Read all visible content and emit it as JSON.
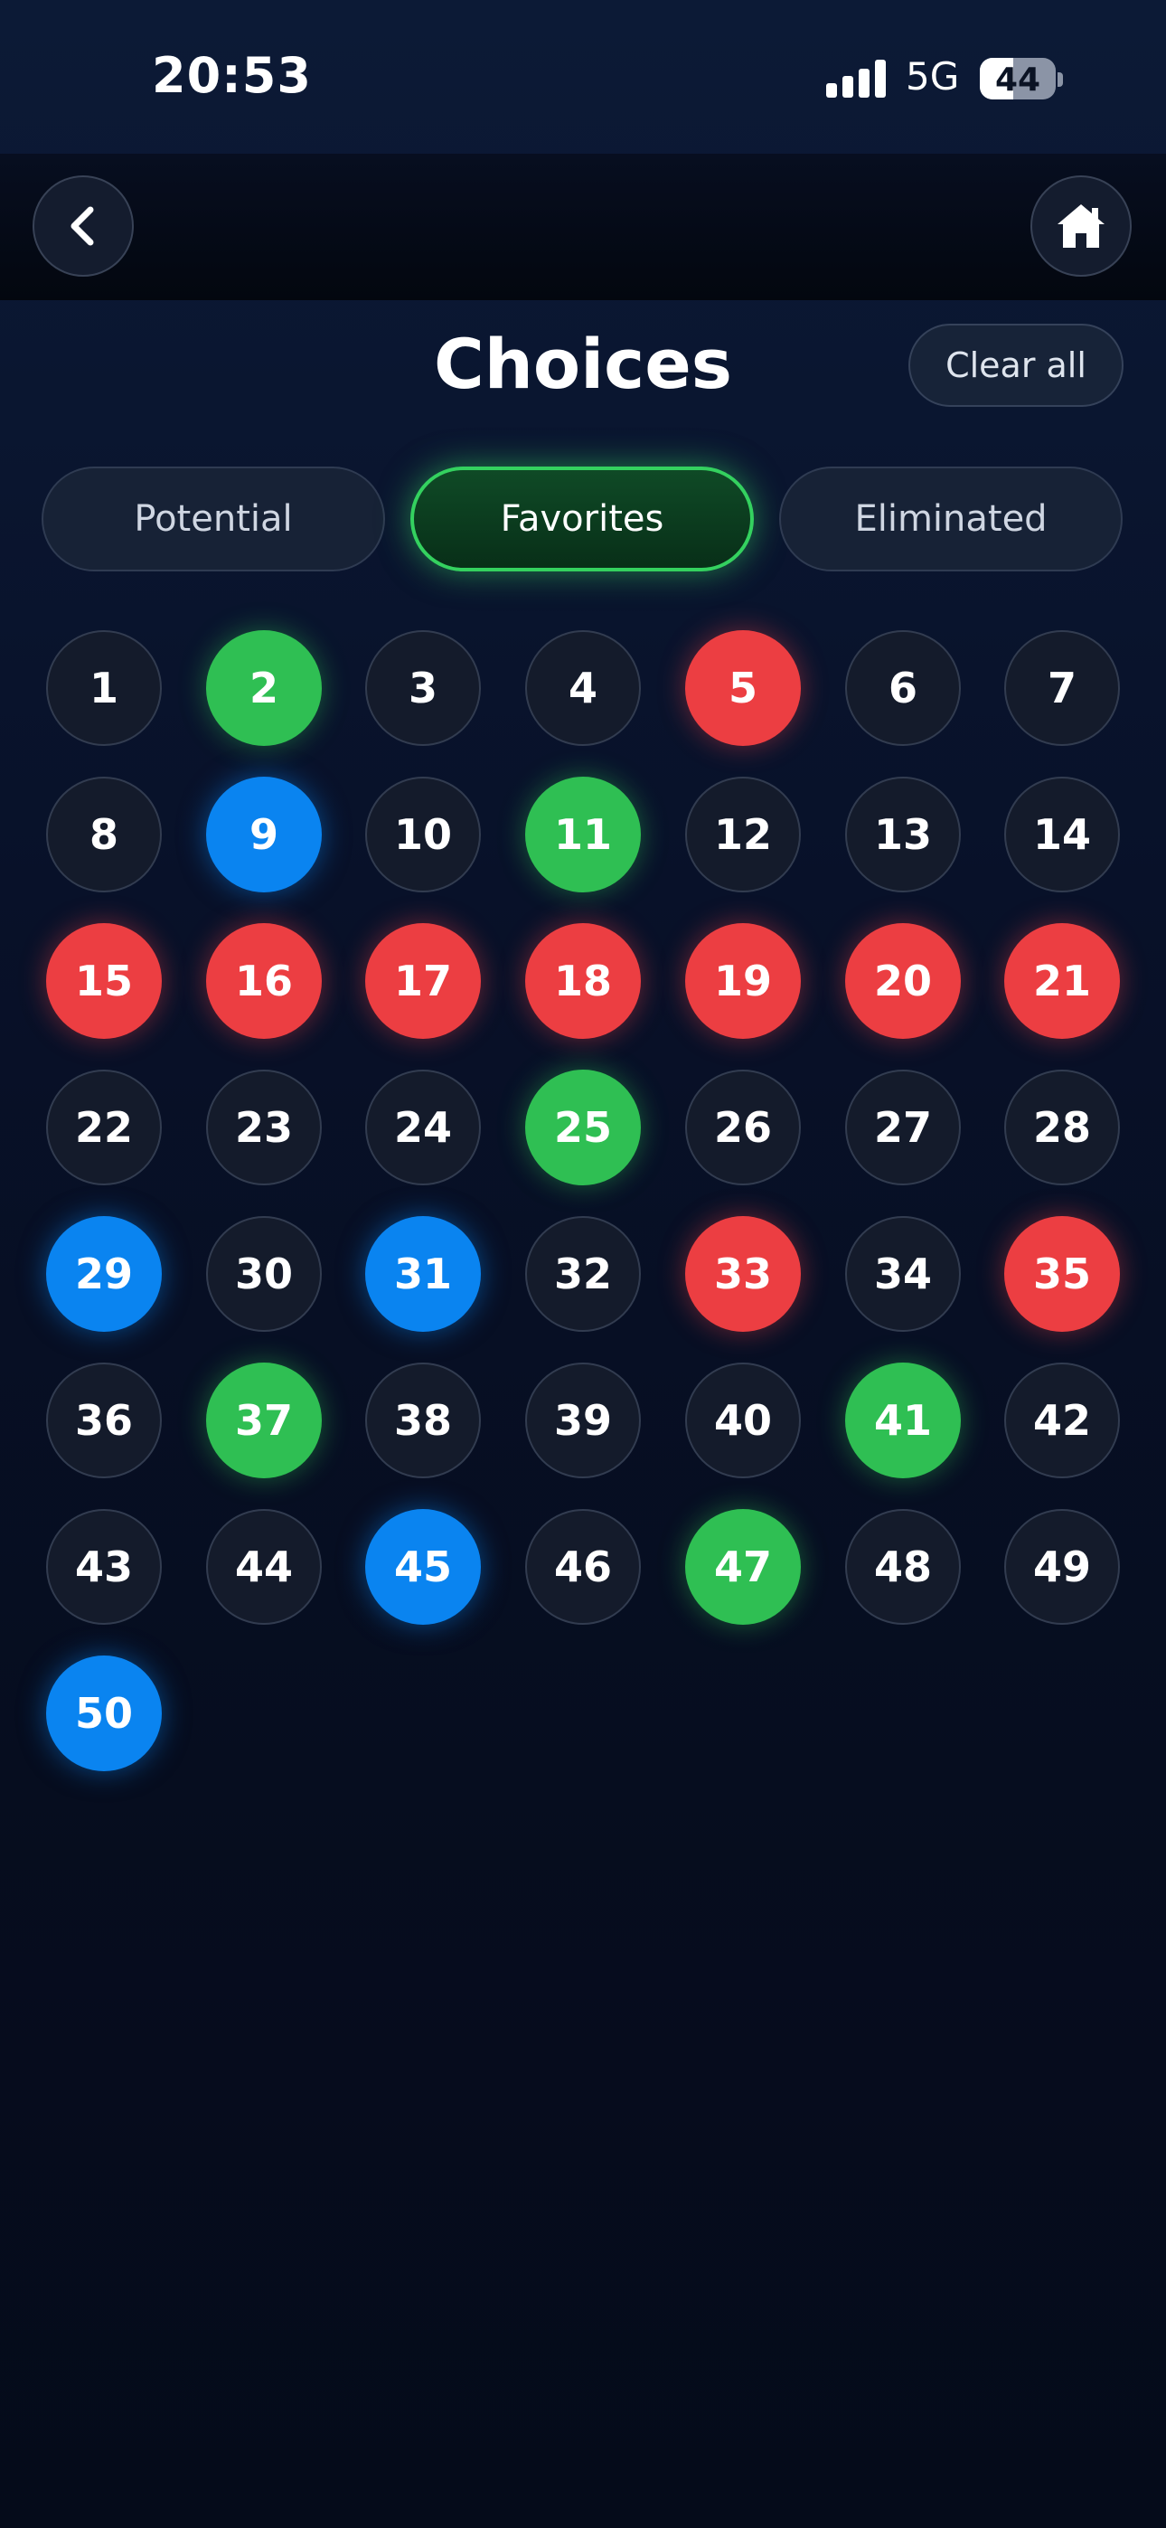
{
  "status_bar": {
    "time": "20:53",
    "network": "5G",
    "battery_level": "44",
    "battery_fraction": 0.44,
    "signal_bars": 4,
    "signal_icon": "cellular-signal-icon",
    "battery_icon": "battery-icon"
  },
  "nav": {
    "back_icon": "chevron-left-icon",
    "home_icon": "home-icon"
  },
  "header": {
    "title": "Choices",
    "clear_label": "Clear all"
  },
  "tabs": [
    {
      "label": "Potential",
      "selected": false
    },
    {
      "label": "Favorites",
      "selected": true
    },
    {
      "label": "Eliminated",
      "selected": false
    }
  ],
  "colors": {
    "background": "#070f22",
    "favorite": "#2fbf53",
    "eliminated": "#ec3e42",
    "potential": "#0a84f0",
    "unmarked": "#141b2b",
    "active_tab_border": "#34d15f"
  },
  "grid": {
    "columns": 7,
    "numbers": [
      {
        "n": "1",
        "state": "none"
      },
      {
        "n": "2",
        "state": "green"
      },
      {
        "n": "3",
        "state": "none"
      },
      {
        "n": "4",
        "state": "none"
      },
      {
        "n": "5",
        "state": "red"
      },
      {
        "n": "6",
        "state": "none"
      },
      {
        "n": "7",
        "state": "none"
      },
      {
        "n": "8",
        "state": "none"
      },
      {
        "n": "9",
        "state": "blue"
      },
      {
        "n": "10",
        "state": "none"
      },
      {
        "n": "11",
        "state": "green"
      },
      {
        "n": "12",
        "state": "none"
      },
      {
        "n": "13",
        "state": "none"
      },
      {
        "n": "14",
        "state": "none"
      },
      {
        "n": "15",
        "state": "red"
      },
      {
        "n": "16",
        "state": "red"
      },
      {
        "n": "17",
        "state": "red"
      },
      {
        "n": "18",
        "state": "red"
      },
      {
        "n": "19",
        "state": "red"
      },
      {
        "n": "20",
        "state": "red"
      },
      {
        "n": "21",
        "state": "red"
      },
      {
        "n": "22",
        "state": "none"
      },
      {
        "n": "23",
        "state": "none"
      },
      {
        "n": "24",
        "state": "none"
      },
      {
        "n": "25",
        "state": "green"
      },
      {
        "n": "26",
        "state": "none"
      },
      {
        "n": "27",
        "state": "none"
      },
      {
        "n": "28",
        "state": "none"
      },
      {
        "n": "29",
        "state": "blue"
      },
      {
        "n": "30",
        "state": "none"
      },
      {
        "n": "31",
        "state": "blue"
      },
      {
        "n": "32",
        "state": "none"
      },
      {
        "n": "33",
        "state": "red"
      },
      {
        "n": "34",
        "state": "none"
      },
      {
        "n": "35",
        "state": "red"
      },
      {
        "n": "36",
        "state": "none"
      },
      {
        "n": "37",
        "state": "green"
      },
      {
        "n": "38",
        "state": "none"
      },
      {
        "n": "39",
        "state": "none"
      },
      {
        "n": "40",
        "state": "none"
      },
      {
        "n": "41",
        "state": "green"
      },
      {
        "n": "42",
        "state": "none"
      },
      {
        "n": "43",
        "state": "none"
      },
      {
        "n": "44",
        "state": "none"
      },
      {
        "n": "45",
        "state": "blue"
      },
      {
        "n": "46",
        "state": "none"
      },
      {
        "n": "47",
        "state": "green"
      },
      {
        "n": "48",
        "state": "none"
      },
      {
        "n": "49",
        "state": "none"
      },
      {
        "n": "50",
        "state": "blue"
      }
    ]
  }
}
